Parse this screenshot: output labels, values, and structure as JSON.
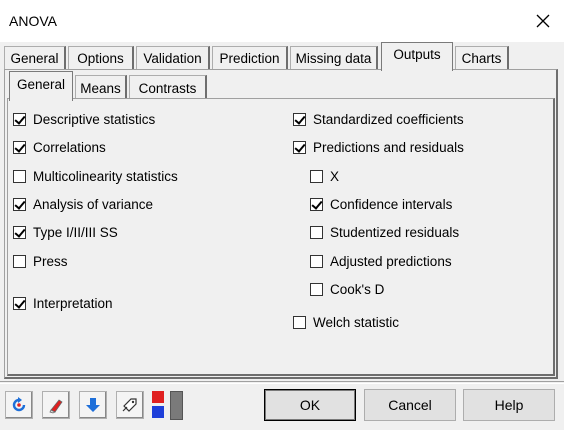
{
  "window": {
    "title": "ANOVA"
  },
  "outer_tabs": [
    "General",
    "Options",
    "Validation",
    "Prediction",
    "Missing data",
    "Outputs",
    "Charts"
  ],
  "outer_active": "Outputs",
  "inner_tabs": [
    "General",
    "Means",
    "Contrasts"
  ],
  "inner_active": "General",
  "left_options": [
    {
      "label": "Descriptive statistics",
      "checked": true
    },
    {
      "label": "Correlations",
      "checked": true
    },
    {
      "label": "Multicolinearity statistics",
      "checked": false
    },
    {
      "label": "Analysis of variance",
      "checked": true
    },
    {
      "label": "Type I/II/III SS",
      "checked": true
    },
    {
      "label": "Press",
      "checked": false
    },
    {
      "label": "Interpretation",
      "checked": true
    }
  ],
  "right_options": [
    {
      "label": "Standardized coefficients",
      "checked": true
    },
    {
      "label": "Predictions and residuals",
      "checked": true
    },
    {
      "label": "X",
      "checked": false
    },
    {
      "label": "Confidence intervals",
      "checked": true
    },
    {
      "label": "Studentized residuals",
      "checked": false
    },
    {
      "label": "Adjusted predictions",
      "checked": false
    },
    {
      "label": "Cook's D",
      "checked": false
    },
    {
      "label": "Welch statistic",
      "checked": false
    }
  ],
  "buttons": {
    "ok": "OK",
    "cancel": "Cancel",
    "help": "Help"
  },
  "colors": {
    "accent_blue": "#1e6fd9",
    "accent_red": "#e02020"
  }
}
